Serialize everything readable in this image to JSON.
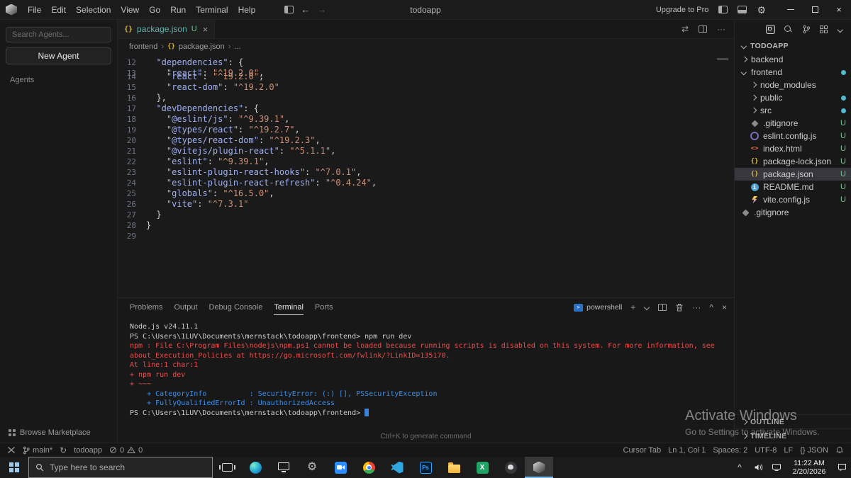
{
  "icons": {
    "braces": "{}",
    "html": "<>",
    "info": "i",
    "gear": "⚙",
    "close": "×",
    "plus": "+",
    "more": "···",
    "back": "←",
    "forward": "→",
    "compare": "⇄",
    "sync": "↻",
    "chevup": "^",
    "crumb_sep": "›"
  },
  "titlebar": {
    "menus": [
      "File",
      "Edit",
      "Selection",
      "View",
      "Go",
      "Run",
      "Terminal",
      "Help"
    ],
    "title": "todoapp",
    "upgrade_label": "Upgrade to Pro"
  },
  "agents": {
    "search_placeholder": "Search Agents...",
    "new_agent_label": "New Agent",
    "section_label": "Agents",
    "browse_label": "Browse Marketplace"
  },
  "editor": {
    "tab": {
      "label": "package.json",
      "badge": "U"
    },
    "breadcrumb": [
      "frontend",
      "package.json",
      "..."
    ],
    "lines": [
      {
        "n": "12",
        "tokens": [
          [
            "k",
            "  \"dependencies\""
          ],
          [
            "p",
            ": {"
          ]
        ]
      },
      {
        "n": "13",
        "overlap": true,
        "tokens": [
          [
            "k",
            "    \"react\""
          ],
          [
            "p",
            ": "
          ],
          [
            "s",
            "\"^19.2.0\""
          ],
          [
            "p",
            ","
          ]
        ]
      },
      {
        "n": "14",
        "tokens": [
          [
            "k",
            "    \"react\""
          ],
          [
            "p",
            ": "
          ],
          [
            "s",
            "\"^19.2.0\""
          ],
          [
            "p",
            ","
          ]
        ]
      },
      {
        "n": "15",
        "tokens": [
          [
            "k",
            "    \"react-dom\""
          ],
          [
            "p",
            ": "
          ],
          [
            "s",
            "\"^19.2.0\""
          ]
        ]
      },
      {
        "n": "16",
        "tokens": [
          [
            "p",
            "  },"
          ]
        ]
      },
      {
        "n": "17",
        "tokens": [
          [
            "k",
            "  \"devDependencies\""
          ],
          [
            "p",
            ": {"
          ]
        ]
      },
      {
        "n": "18",
        "tokens": [
          [
            "k",
            "    \"@eslint/js\""
          ],
          [
            "p",
            ": "
          ],
          [
            "s",
            "\"^9.39.1\""
          ],
          [
            "p",
            ","
          ]
        ]
      },
      {
        "n": "19",
        "tokens": [
          [
            "k",
            "    \"@types/react\""
          ],
          [
            "p",
            ": "
          ],
          [
            "s",
            "\"^19.2.7\""
          ],
          [
            "p",
            ","
          ]
        ]
      },
      {
        "n": "20",
        "tokens": [
          [
            "k",
            "    \"@types/react-dom\""
          ],
          [
            "p",
            ": "
          ],
          [
            "s",
            "\"^19.2.3\""
          ],
          [
            "p",
            ","
          ]
        ]
      },
      {
        "n": "21",
        "tokens": [
          [
            "k",
            "    \"@vitejs/plugin-react\""
          ],
          [
            "p",
            ": "
          ],
          [
            "s",
            "\"^5.1.1\""
          ],
          [
            "p",
            ","
          ]
        ]
      },
      {
        "n": "22",
        "tokens": [
          [
            "k",
            "    \"eslint\""
          ],
          [
            "p",
            ": "
          ],
          [
            "s",
            "\"^9.39.1\""
          ],
          [
            "p",
            ","
          ]
        ]
      },
      {
        "n": "23",
        "tokens": [
          [
            "k",
            "    \"eslint-plugin-react-hooks\""
          ],
          [
            "p",
            ": "
          ],
          [
            "s",
            "\"^7.0.1\""
          ],
          [
            "p",
            ","
          ]
        ]
      },
      {
        "n": "24",
        "tokens": [
          [
            "k",
            "    \"eslint-plugin-react-refresh\""
          ],
          [
            "p",
            ": "
          ],
          [
            "s",
            "\"^0.4.24\""
          ],
          [
            "p",
            ","
          ]
        ]
      },
      {
        "n": "25",
        "tokens": [
          [
            "k",
            "    \"globals\""
          ],
          [
            "p",
            ": "
          ],
          [
            "s",
            "\"^16.5.0\""
          ],
          [
            "p",
            ","
          ]
        ]
      },
      {
        "n": "26",
        "tokens": [
          [
            "k",
            "    \"vite\""
          ],
          [
            "p",
            ": "
          ],
          [
            "s",
            "\"^7.3.1\""
          ]
        ]
      },
      {
        "n": "27",
        "tokens": [
          [
            "p",
            "  }"
          ]
        ]
      },
      {
        "n": "28",
        "tokens": [
          [
            "p",
            "}"
          ]
        ]
      },
      {
        "n": "29",
        "tokens": []
      }
    ]
  },
  "terminal": {
    "tabs": [
      "Problems",
      "Output",
      "Debug Console",
      "Terminal",
      "Ports"
    ],
    "active_tab": "Terminal",
    "shell_label": "powershell",
    "hint": "Ctrl+K to generate command",
    "lines": [
      {
        "c": "fg",
        "t": "Node.js v24.11.1"
      },
      {
        "c": "fg",
        "t": "PS C:\\Users\\1LUV\\Documents\\mernstack\\todoapp\\frontend> npm run dev"
      },
      {
        "c": "red",
        "t": "npm : File C:\\Program Files\\nodejs\\npm.ps1 cannot be loaded because running scripts is disabled on this system. For more information, see"
      },
      {
        "c": "red",
        "t": "about_Execution_Policies at https://go.microsoft.com/fwlink/?LinkID=135170."
      },
      {
        "c": "red",
        "t": "At line:1 char:1"
      },
      {
        "c": "red",
        "t": "+ npm run dev"
      },
      {
        "c": "red",
        "t": "+ ~~~"
      },
      {
        "c": "blue",
        "t": "    + CategoryInfo          : SecurityError: (:) [], PSSecurityException"
      },
      {
        "c": "blue",
        "t": "    + FullyQualifiedErrorId : UnauthorizedAccess"
      },
      {
        "c": "fg",
        "t": "PS C:\\Users\\1LUV\\Documents\\mernstack\\todoapp\\frontend> ",
        "cursor": true
      }
    ]
  },
  "explorer": {
    "root": "TODOAPP",
    "items": [
      {
        "label": "backend",
        "folder": true,
        "expanded": false,
        "depth": 0
      },
      {
        "label": "frontend",
        "folder": true,
        "expanded": true,
        "depth": 0,
        "dot": true
      },
      {
        "label": "node_modules",
        "folder": true,
        "expanded": false,
        "depth": 1
      },
      {
        "label": "public",
        "folder": true,
        "expanded": false,
        "depth": 1,
        "dot": true
      },
      {
        "label": "src",
        "folder": true,
        "expanded": false,
        "depth": 1,
        "dot": true
      },
      {
        "label": ".gitignore",
        "icon": "git",
        "depth": 1,
        "badge": "U"
      },
      {
        "label": "eslint.config.js",
        "icon": "eslint",
        "depth": 1,
        "badge": "U"
      },
      {
        "label": "index.html",
        "icon": "html",
        "depth": 1,
        "badge": "U"
      },
      {
        "label": "package-lock.json",
        "icon": "json",
        "depth": 1,
        "badge": "U"
      },
      {
        "label": "package.json",
        "icon": "json",
        "depth": 1,
        "badge": "U",
        "selected": true
      },
      {
        "label": "README.md",
        "icon": "readme",
        "depth": 1,
        "badge": "U"
      },
      {
        "label": "vite.config.js",
        "icon": "vite",
        "depth": 1,
        "badge": "U"
      },
      {
        "label": ".gitignore",
        "icon": "git",
        "depth": 0
      }
    ],
    "bottom_sections": [
      "OUTLINE",
      "TIMELINE"
    ]
  },
  "statusbar": {
    "branch": "main*",
    "project": "todoapp",
    "errors": "0",
    "warnings": "0",
    "right_items": [
      "Cursor Tab",
      "Ln 1, Col 1",
      "Spaces: 2",
      "UTF-8",
      "LF",
      "{} JSON"
    ]
  },
  "watermark": {
    "line1": "Activate Windows",
    "line2": "Go to Settings to activate Windows."
  },
  "taskbar": {
    "search_placeholder": "Type here to search",
    "time": "11:22 AM",
    "date": "2/20/2026",
    "photoshop_label": "Ps",
    "excel_label": "X"
  }
}
